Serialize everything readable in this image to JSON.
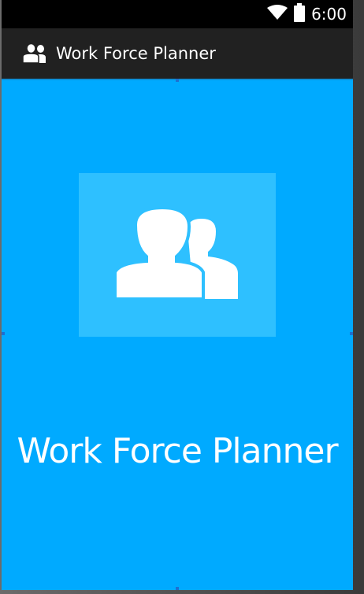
{
  "status_bar": {
    "time": "6:00",
    "icons": [
      "wifi-icon",
      "battery-icon"
    ]
  },
  "action_bar": {
    "title": "Work Force Planner",
    "icon": "users-icon"
  },
  "splash": {
    "logo_icon": "users-icon",
    "title": "Work Force Planner"
  },
  "colors": {
    "background": "#00aaff",
    "logo_tile": "#2ec0ff",
    "action_bar": "#212121",
    "status_bar": "#000000",
    "text": "#ffffff"
  }
}
